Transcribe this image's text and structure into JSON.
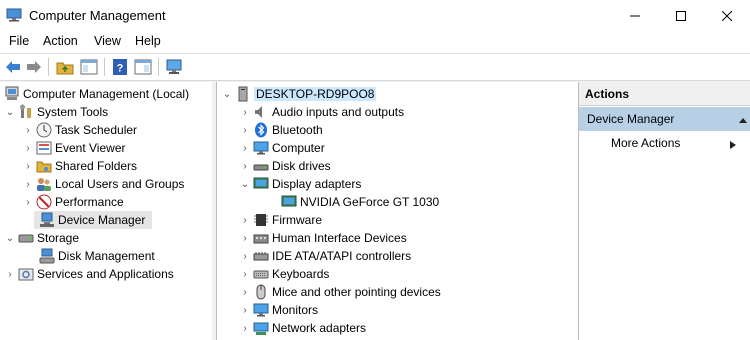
{
  "window": {
    "title": "Computer Management"
  },
  "menu": [
    "File",
    "Action",
    "View",
    "Help"
  ],
  "left_tree": {
    "root": "Computer Management (Local)",
    "system_tools": "System Tools",
    "task_scheduler": "Task Scheduler",
    "event_viewer": "Event Viewer",
    "shared_folders": "Shared Folders",
    "local_users": "Local Users and Groups",
    "performance": "Performance",
    "device_manager": "Device Manager",
    "storage": "Storage",
    "disk_management": "Disk Management",
    "services": "Services and Applications"
  },
  "device_tree": {
    "root": "DESKTOP-RD9POO8",
    "audio": "Audio inputs and outputs",
    "bluetooth": "Bluetooth",
    "computer": "Computer",
    "disk_drives": "Disk drives",
    "display_adapters": "Display adapters",
    "gpu": "NVIDIA GeForce GT 1030",
    "firmware": "Firmware",
    "hid": "Human Interface Devices",
    "ide": "IDE ATA/ATAPI controllers",
    "keyboards": "Keyboards",
    "mice": "Mice and other pointing devices",
    "monitors": "Monitors",
    "network": "Network adapters"
  },
  "actions": {
    "header": "Actions",
    "section": "Device Manager",
    "more": "More Actions"
  },
  "colors": {
    "accent": "#0078d7",
    "selection": "#cce8ff",
    "actions_section": "#b8d0e6"
  }
}
